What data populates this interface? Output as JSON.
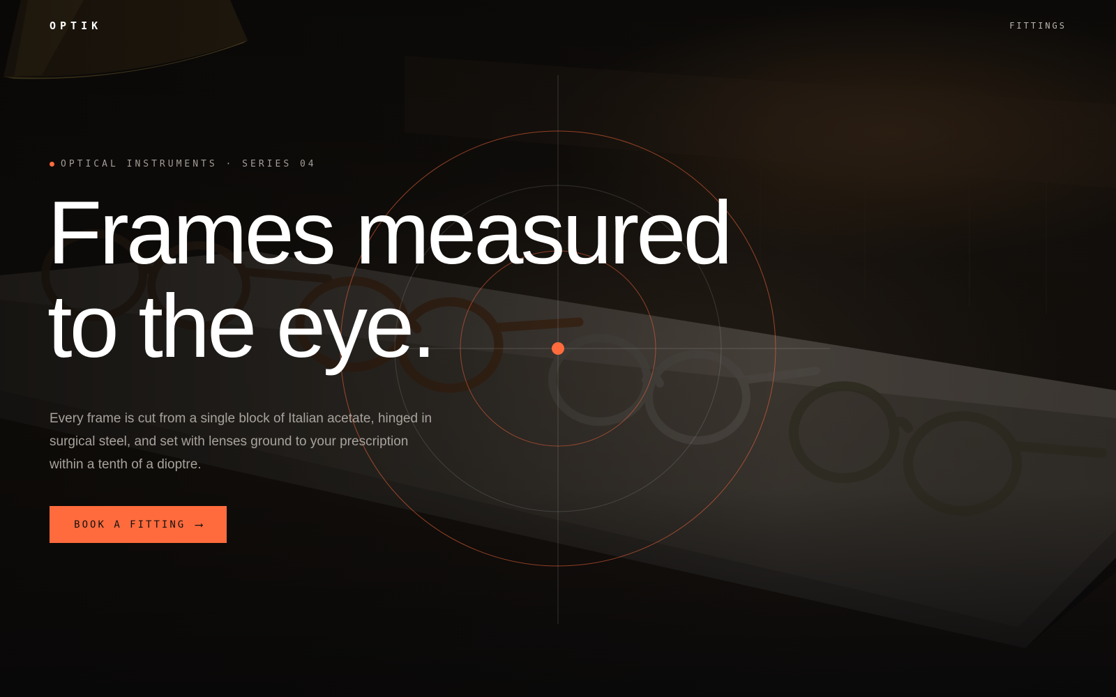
{
  "nav": {
    "brand": "OPTIK",
    "link_label": "FITTINGS"
  },
  "hero": {
    "eyebrow": "OPTICAL INSTRUMENTS · SERIES 04",
    "headline_line1": "Frames measured",
    "headline_line2": "to the eye.",
    "body": "Every frame is cut from a single block of Italian acetate, hinged in surgical steel, and set with lenses ground to your prescription within a tenth of a dioptre.",
    "cta_label": "BOOK A FITTING",
    "cta_arrow": "⟶"
  },
  "colors": {
    "accent": "#ff6b3d",
    "background": "#0a0908",
    "text": "#ffffff",
    "muted": "#a8a29c"
  },
  "icons": {
    "cta_arrow": "long-right-arrow-icon",
    "eyebrow_dot": "accent-dot-icon",
    "reticle": "crosshair-reticle-icon"
  }
}
